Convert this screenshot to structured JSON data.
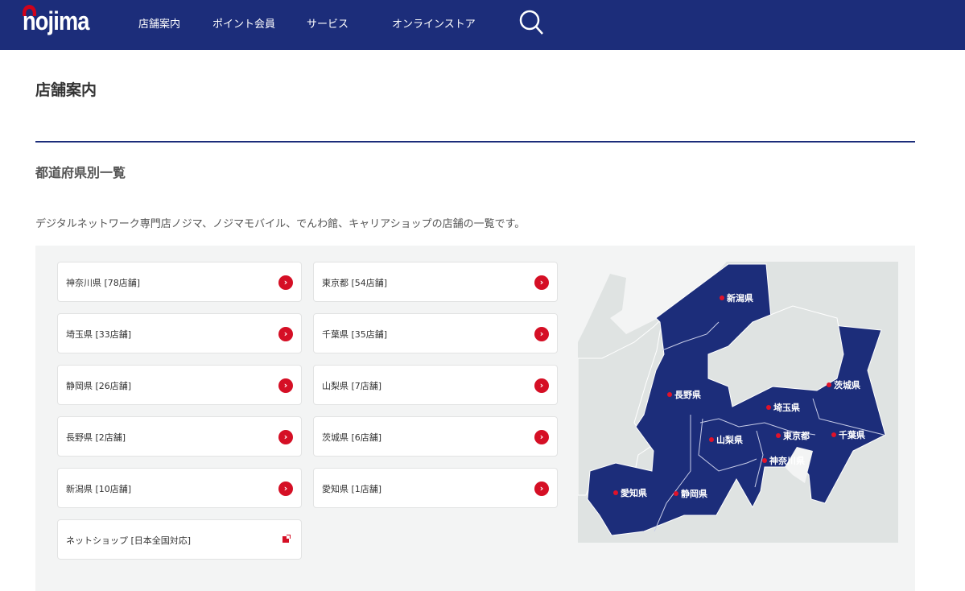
{
  "header": {
    "logo": "nojima",
    "nav": [
      "店舗案内",
      "ポイント会員",
      "サービス",
      "オンラインストア"
    ],
    "search_icon": "search-icon"
  },
  "page": {
    "title": "店舗案内",
    "subtitle": "都道府県別一覧",
    "description": "デジタルネットワーク専門店ノジマ、ノジマモバイル、でんわ館、キャリアショップの店舗の一覧です。"
  },
  "prefectures": [
    {
      "label": "神奈川県 [78店舗]"
    },
    {
      "label": "東京都 [54店舗]"
    },
    {
      "label": "埼玉県 [33店舗]"
    },
    {
      "label": "千葉県 [35店舗]"
    },
    {
      "label": "静岡県 [26店舗]"
    },
    {
      "label": "山梨県 [7店舗]"
    },
    {
      "label": "長野県 [2店舗]"
    },
    {
      "label": "茨城県 [6店舗]"
    },
    {
      "label": "新潟県 [10店舗]"
    },
    {
      "label": "愛知県 [1店舗]"
    },
    {
      "label": "ネットショップ [日本全国対応]"
    }
  ],
  "map_labels": [
    "新潟県",
    "長野県",
    "茨城県",
    "埼玉県",
    "山梨県",
    "東京都",
    "千葉県",
    "神奈川県",
    "愛知県",
    "静岡県"
  ],
  "colors": {
    "navy": "#1c2d7a",
    "red": "#d50f25",
    "panel": "#f3f4f4"
  }
}
